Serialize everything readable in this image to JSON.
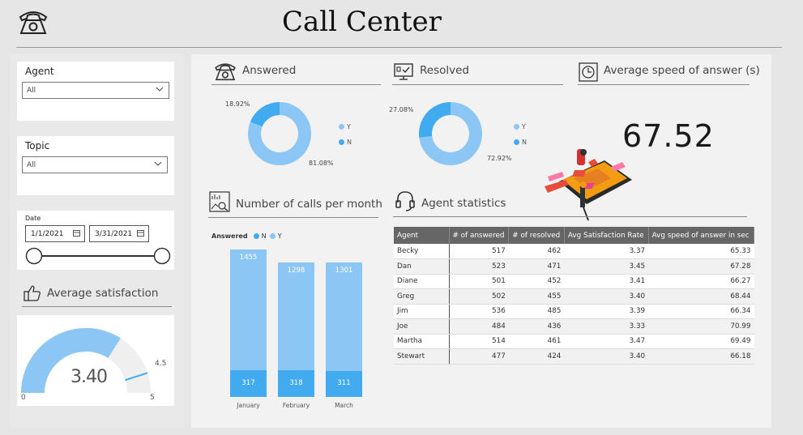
{
  "header": {
    "title": "Call Center",
    "icon": "telephone-icon"
  },
  "filters": {
    "agent": {
      "label": "Agent",
      "value": "All"
    },
    "topic": {
      "label": "Topic",
      "value": "All"
    },
    "date": {
      "label": "Date",
      "start": "1/1/2021",
      "end": "3/31/2021"
    }
  },
  "satisfaction": {
    "title": "Average satisfaction",
    "value": "3.40",
    "min": "0",
    "max": "5",
    "target": "4.5",
    "level": 3.4,
    "range": [
      0,
      5
    ],
    "target_value": 4.5
  },
  "answered": {
    "title": "Answered",
    "labels": {
      "small": "18.92%",
      "large": "81.08%"
    },
    "legend": {
      "y": "Y",
      "n": "N"
    }
  },
  "resolved": {
    "title": "Resolved",
    "labels": {
      "small": "27.08%",
      "large": "72.92%"
    },
    "legend": {
      "y": "Y",
      "n": "N"
    }
  },
  "speed": {
    "title": "Average speed of answer (s)",
    "value": "67.52"
  },
  "monthly": {
    "title": "Number of calls per month",
    "legend_title": "Answered",
    "legend_n": "N",
    "legend_y": "Y"
  },
  "agent_stats": {
    "title": "Agent statistics",
    "columns": [
      "Agent",
      "# of answered",
      "# of resolved",
      "Avg Satisfaction Rate",
      "Avg speed of answer in sec"
    ],
    "rows": [
      [
        "Becky",
        "517",
        "462",
        "3.37",
        "65.33"
      ],
      [
        "Dan",
        "523",
        "471",
        "3.45",
        "67.28"
      ],
      [
        "Diane",
        "501",
        "452",
        "3.41",
        "66.27"
      ],
      [
        "Greg",
        "502",
        "455",
        "3.40",
        "68.44"
      ],
      [
        "Jim",
        "536",
        "485",
        "3.39",
        "66.34"
      ],
      [
        "Joe",
        "484",
        "436",
        "3.33",
        "70.99"
      ],
      [
        "Martha",
        "514",
        "461",
        "3.47",
        "69.49"
      ],
      [
        "Stewart",
        "477",
        "424",
        "3.40",
        "66.18"
      ]
    ]
  },
  "colors": {
    "light_blue": "#8cc6f5",
    "dark_blue": "#42abf0",
    "gauge_bg": "#efefef",
    "panel": "#f2f2f2"
  },
  "chart_data": [
    {
      "type": "pie",
      "title": "Answered",
      "categories": [
        "Y",
        "N"
      ],
      "values": [
        81.08,
        18.92
      ]
    },
    {
      "type": "pie",
      "title": "Resolved",
      "categories": [
        "Y",
        "N"
      ],
      "values": [
        72.92,
        27.08
      ]
    },
    {
      "type": "bar",
      "title": "Number of calls per month",
      "categories": [
        "January",
        "February",
        "March"
      ],
      "series": [
        {
          "name": "N",
          "values": [
            317,
            318,
            311
          ]
        },
        {
          "name": "Y",
          "values": [
            1455,
            1298,
            1301
          ]
        }
      ],
      "stacked": true,
      "legend": "top-left"
    }
  ]
}
